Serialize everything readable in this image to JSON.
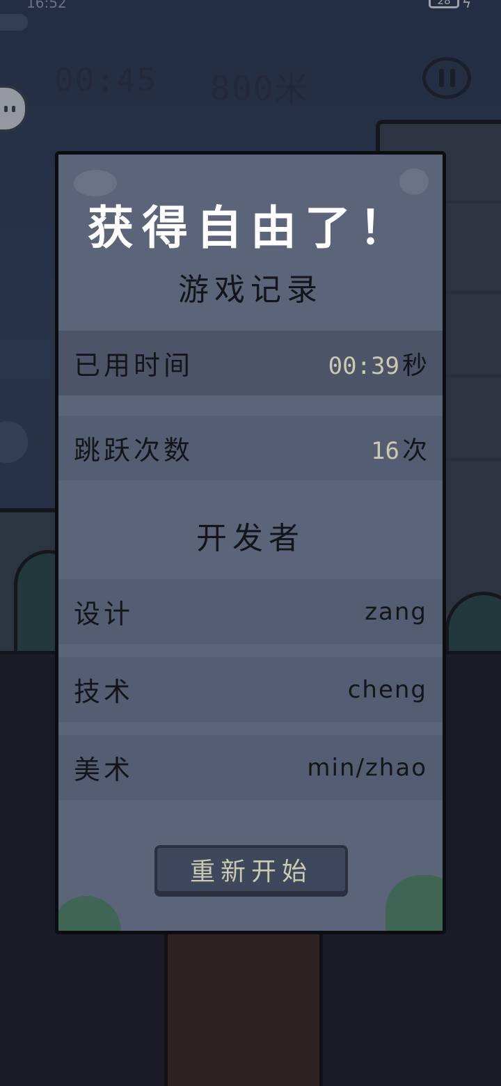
{
  "status_bar": {
    "time": "16:52",
    "battery": "28"
  },
  "hud": {
    "timer": "00:45",
    "distance": "800米"
  },
  "dialog": {
    "title": "获得自由了！",
    "record_heading": "游戏记录",
    "records": [
      {
        "label": "已用时间",
        "value": "00:39",
        "unit": "秒"
      },
      {
        "label": "跳跃次数",
        "value": "16",
        "unit": "次"
      }
    ],
    "developer_heading": "开发者",
    "developers": [
      {
        "role": "设计",
        "name": "zang"
      },
      {
        "role": "技术",
        "name": "cheng"
      },
      {
        "role": "美术",
        "name": "min/zhao"
      }
    ],
    "restart_label": "重新开始"
  }
}
